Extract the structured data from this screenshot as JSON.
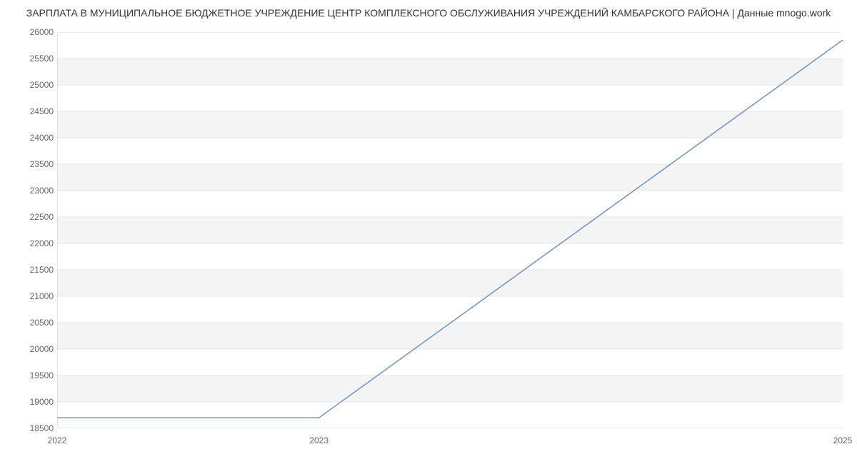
{
  "chart_data": {
    "type": "line",
    "title": "ЗАРПЛАТА В МУНИЦИПАЛЬНОЕ БЮДЖЕТНОЕ УЧРЕЖДЕНИЕ ЦЕНТР КОМПЛЕКСНОГО ОБСЛУЖИВАНИЯ УЧРЕЖДЕНИЙ КАМБАРСКОГО РАЙОНА | Данные mnogo.work",
    "x": [
      2022,
      2023,
      2025
    ],
    "values": [
      18700,
      18700,
      25850
    ],
    "xlabel": "",
    "ylabel": "",
    "xlim": [
      2022,
      2025
    ],
    "ylim": [
      18500,
      26000
    ],
    "x_ticks": [
      2022,
      2023,
      2025
    ],
    "x_tick_labels": [
      "2022",
      "2023",
      "2025"
    ],
    "y_ticks": [
      18500,
      19000,
      19500,
      20000,
      20500,
      21000,
      21500,
      22000,
      22500,
      23000,
      23500,
      24000,
      24500,
      25000,
      25500,
      26000
    ],
    "y_tick_labels": [
      "18500",
      "19000",
      "19500",
      "20000",
      "20500",
      "21000",
      "21500",
      "22000",
      "22500",
      "23000",
      "23500",
      "24000",
      "24500",
      "25000",
      "25500",
      "26000"
    ],
    "colors": {
      "line": "#6f93c8",
      "band": "#f4f4f4",
      "axis": "#bfc8cf",
      "tick_text": "#666666",
      "title_text": "#333333",
      "plot_bg": "#ffffff"
    }
  }
}
